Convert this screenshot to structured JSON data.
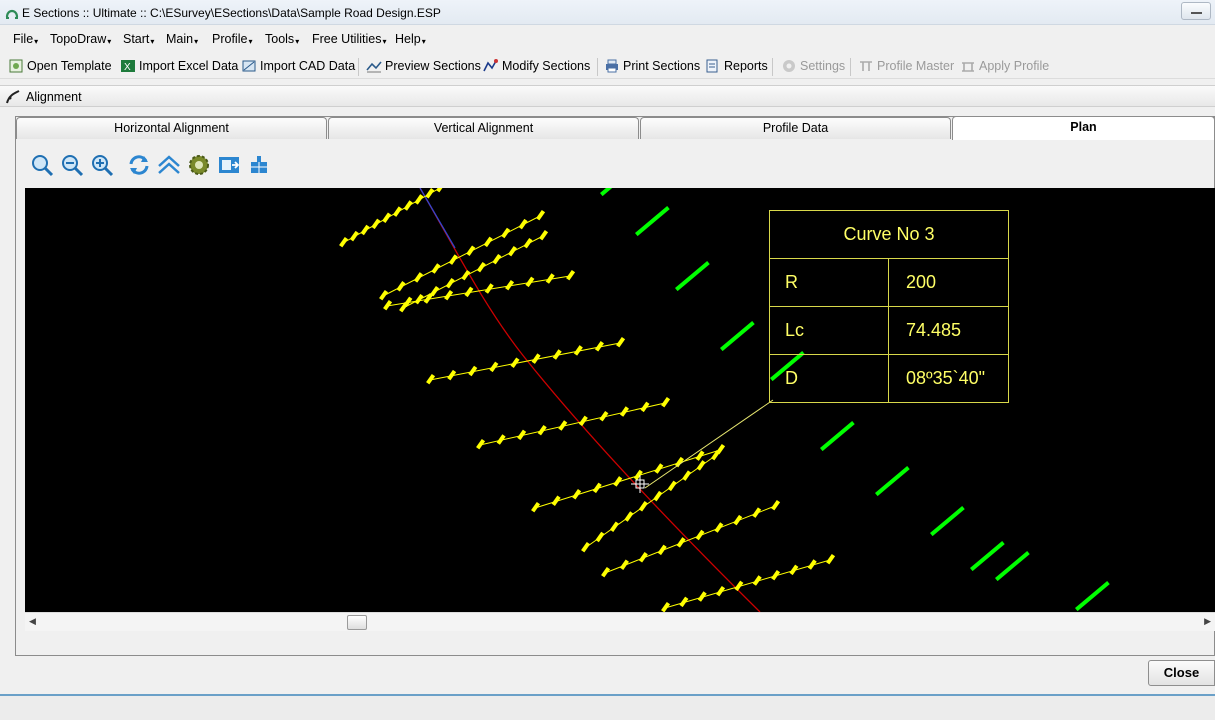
{
  "window": {
    "title": "E Sections :: Ultimate :: C:\\ESurvey\\ESections\\Data\\Sample Road Design.ESP"
  },
  "menu": [
    "File",
    "TopoDraw",
    "Start",
    "Main",
    "Profile",
    "Tools",
    "Free Utilities",
    "Help"
  ],
  "toolbar": {
    "open_template": "Open Template",
    "import_excel": "Import Excel Data",
    "import_cad": "Import CAD Data",
    "preview_sections": "Preview Sections",
    "modify_sections": "Modify Sections",
    "print_sections": "Print Sections",
    "reports": "Reports",
    "settings": "Settings",
    "profile_master": "Profile Master",
    "apply_profile": "Apply Profile"
  },
  "panel": {
    "title": "Alignment"
  },
  "tabs": {
    "horizontal": "Horizontal Alignment",
    "vertical": "Vertical Alignment",
    "profile_data": "Profile Data",
    "plan": "Plan",
    "active": "Plan"
  },
  "view_tools": [
    "zoom-window-icon",
    "zoom-out-icon",
    "zoom-in-icon",
    "refresh-icon",
    "chevron-up-icon",
    "settings-gear-icon",
    "export-icon",
    "grid-icon"
  ],
  "curve_info": {
    "title": "Curve No 3",
    "rows": [
      {
        "key": "R",
        "value": "200"
      },
      {
        "key": "Lc",
        "value": "74.485"
      },
      {
        "key": "D",
        "value": "08º35`40\""
      }
    ]
  },
  "buttons": {
    "close": "Close"
  },
  "colors": {
    "canvas_bg": "#000000",
    "sections": "#ffff00",
    "alignment": "#cc0000",
    "labels": "#00ff00",
    "annotation": "#ffff66"
  }
}
